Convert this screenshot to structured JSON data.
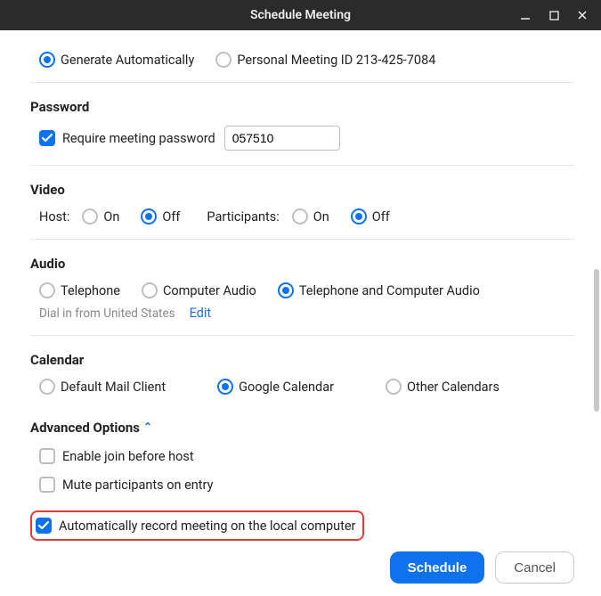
{
  "window": {
    "title": "Schedule Meeting"
  },
  "meetingId": {
    "generate_label": "Generate Automatically",
    "pmi_label": "Personal Meeting ID 213-425-7084"
  },
  "password": {
    "section": "Password",
    "require_label": "Require meeting password",
    "value": "057510"
  },
  "video": {
    "section": "Video",
    "host_label": "Host:",
    "participants_label": "Participants:",
    "on": "On",
    "off": "Off"
  },
  "audio": {
    "section": "Audio",
    "telephone": "Telephone",
    "computer": "Computer Audio",
    "both": "Telephone and Computer Audio",
    "dial_note": "Dial in from United States",
    "edit": "Edit"
  },
  "calendar": {
    "section": "Calendar",
    "default": "Default Mail Client",
    "google": "Google Calendar",
    "other": "Other Calendars"
  },
  "advanced": {
    "section": "Advanced Options",
    "join_before": "Enable join before host",
    "mute_entry": "Mute participants on entry",
    "auto_record": "Automatically record meeting on the local computer"
  },
  "footer": {
    "schedule": "Schedule",
    "cancel": "Cancel"
  }
}
